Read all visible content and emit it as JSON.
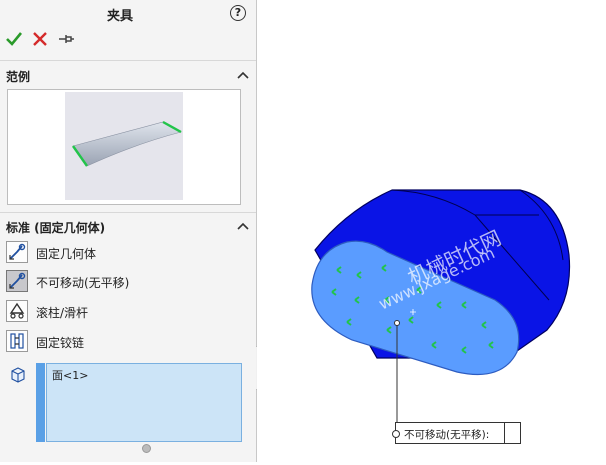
{
  "panel": {
    "title": "夹具",
    "help_glyph": "?",
    "ok_icon": "check-icon",
    "cancel_icon": "x-icon",
    "pin_icon": "pushpin-icon",
    "example_section": "范例",
    "standard_section": "标准 (固定几何体)",
    "options": [
      {
        "label": "固定几何体",
        "icon": "fixed-geometry-icon"
      },
      {
        "label": "不可移动(无平移)",
        "icon": "immovable-icon",
        "selected": true
      },
      {
        "label": "滚柱/滑杆",
        "icon": "roller-slider-icon"
      },
      {
        "label": "固定铰链",
        "icon": "fixed-hinge-icon"
      }
    ],
    "selection_items": [
      "面<1>"
    ]
  },
  "viewport": {
    "watermark_cn": "机械时代网",
    "watermark_url": "www.jxage.com",
    "callout_label": "不可移动(无平移):"
  },
  "colors": {
    "accent_blue": "#0a14e6",
    "face_blue": "#5a9cff",
    "fixture_green": "#22c44a",
    "ok_green": "#2a9a2a",
    "cancel_red": "#d42a2a"
  }
}
